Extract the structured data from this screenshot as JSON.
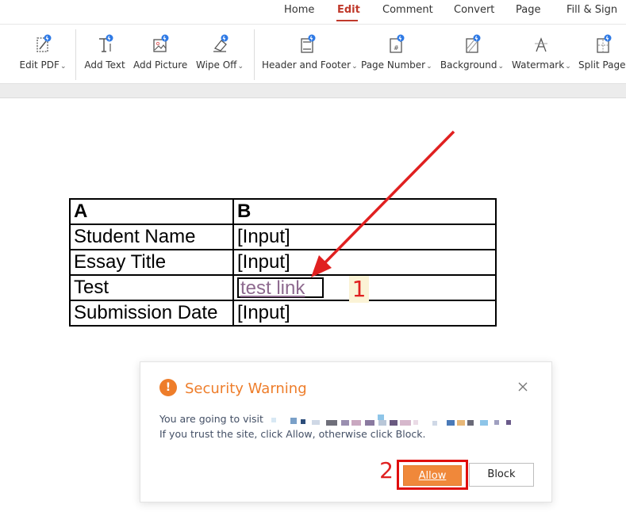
{
  "menu": {
    "tabs": [
      {
        "label": "Home"
      },
      {
        "label": "Edit"
      },
      {
        "label": "Comment"
      },
      {
        "label": "Convert"
      },
      {
        "label": "Page"
      },
      {
        "label": "Fill & Sign"
      }
    ],
    "active_tab": "Edit"
  },
  "ribbon": {
    "tools": [
      {
        "label": "Edit PDF",
        "icon": "edit-pdf-icon",
        "dropdown": true
      },
      {
        "label": "Add Text",
        "icon": "add-text-icon",
        "dropdown": false
      },
      {
        "label": "Add Picture",
        "icon": "add-picture-icon",
        "dropdown": false
      },
      {
        "label": "Wipe Off",
        "icon": "eraser-icon",
        "dropdown": true
      },
      {
        "label": "Header and Footer",
        "icon": "header-footer-icon",
        "dropdown": true
      },
      {
        "label": "Page Number",
        "icon": "page-number-icon",
        "dropdown": true
      },
      {
        "label": "Background",
        "icon": "background-icon",
        "dropdown": true
      },
      {
        "label": "Watermark",
        "icon": "watermark-icon",
        "dropdown": true
      },
      {
        "label": "Split Pages",
        "icon": "split-pages-icon",
        "dropdown": false
      }
    ],
    "caret": "⌄"
  },
  "table": {
    "header": [
      "A",
      "B"
    ],
    "rows": [
      {
        "label": "Student Name",
        "value": "[Input]"
      },
      {
        "label": "Essay Title",
        "value": "[Input]"
      },
      {
        "label": "Test",
        "value": "test link"
      },
      {
        "label": "Submission Date",
        "value": "[Input]"
      }
    ]
  },
  "annotations": {
    "step1": "1",
    "step2": "2",
    "arrow_color": "#e02020"
  },
  "dialog": {
    "title": "Security Warning",
    "message_line1": "You are going to visit",
    "message_line2": "If you trust the site, click Allow, otherwise click Block.",
    "allow_label": "Allow",
    "block_label": "Block",
    "accent_color": "#ee7d2a"
  },
  "colors": {
    "active_tab": "#c0392b",
    "link": "#8e6a8f",
    "allow_button": "#f0883a",
    "highlight_box": "#e00d0d"
  }
}
